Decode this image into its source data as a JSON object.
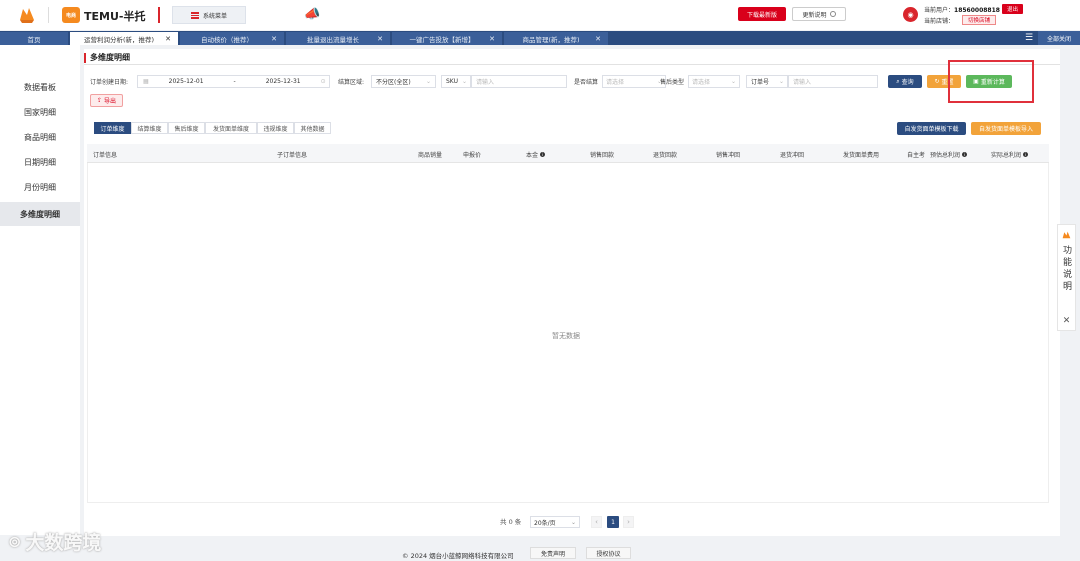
{
  "header": {
    "brand": "TEMU-半托",
    "logo2_text": "电商",
    "system_menu": "系统菜单",
    "download_btn": "下载最新版",
    "update_note_btn": "更新说明",
    "current_user_label": "当前用户：",
    "current_user": "18560008818",
    "logout": "退出",
    "current_shop_label": "当前店铺：",
    "switch_shop": "切换店铺"
  },
  "tabs": [
    {
      "label": "首页",
      "active": false,
      "closable": false
    },
    {
      "label": "运营利润分析(新，推荐)",
      "active": true,
      "closable": true
    },
    {
      "label": "自动核价（推荐）",
      "active": false,
      "closable": true
    },
    {
      "label": "批量退出流量增长",
      "active": false,
      "closable": true
    },
    {
      "label": "一键广告投放【新增】",
      "active": false,
      "closable": true
    },
    {
      "label": "商品管理(新，推荐)",
      "active": false,
      "closable": true
    }
  ],
  "close_all": "全部关闭",
  "sidebar": {
    "items": [
      {
        "label": "数据看板",
        "active": false
      },
      {
        "label": "国家明细",
        "active": false
      },
      {
        "label": "商品明细",
        "active": false
      },
      {
        "label": "日期明细",
        "active": false
      },
      {
        "label": "月份明细",
        "active": false
      },
      {
        "label": "多维度明细",
        "active": true
      }
    ]
  },
  "page_title": "多维度明细",
  "filters": {
    "order_date_label": "订单创建日期:",
    "start_date": "2025-12-01",
    "date_sep": "-",
    "end_date": "2025-12-31",
    "region_label": "结算区域:",
    "region_value": "不分区(全区)",
    "sku_select": "SKU",
    "sku_placeholder": "请输入",
    "settled_label": "是否结算",
    "settled_placeholder": "请选择",
    "aftersale_label": "售后类型",
    "aftersale_placeholder": "请选择",
    "order_no_select": "订单号",
    "order_no_placeholder": "请输入"
  },
  "buttons": {
    "query": "查询",
    "reset": "重置",
    "recalc": "重新计算",
    "export": "导出",
    "download_template": "自发货面单模板下载",
    "import_template": "自发货面单模板导入"
  },
  "dimension_tabs": [
    {
      "label": "订单维度",
      "active": true
    },
    {
      "label": "结算维度",
      "active": false
    },
    {
      "label": "售后维度",
      "active": false
    },
    {
      "label": "发货面单维度",
      "active": false
    },
    {
      "label": "违规维度",
      "active": false
    },
    {
      "label": "其他数据",
      "active": false
    }
  ],
  "table": {
    "columns": [
      {
        "label": "订单信息",
        "info": false
      },
      {
        "label": "子订单信息",
        "info": false
      },
      {
        "label": "商品销量",
        "info": false
      },
      {
        "label": "申报价",
        "info": false
      },
      {
        "label": "本金",
        "info": true
      },
      {
        "label": "销售回款",
        "info": false
      },
      {
        "label": "退货回款",
        "info": false
      },
      {
        "label": "销售冲回",
        "info": false
      },
      {
        "label": "退货冲回",
        "info": false
      },
      {
        "label": "发货面单费用",
        "info": false
      },
      {
        "label": "自主考",
        "info": false
      },
      {
        "label": "预估总利润",
        "info": true
      },
      {
        "label": "实际总利润",
        "info": true
      }
    ],
    "empty_text": "暂无数据"
  },
  "pagination": {
    "total": "共 0 条",
    "page_size": "20条/页",
    "current_page": "1"
  },
  "footer": {
    "copyright": "© 2024 烟台小蓝鲸网络科技有限公司",
    "disclaimer": "免责声明",
    "license": "授权协议"
  },
  "side_widget": {
    "label": "功能说明"
  },
  "watermark": "大数跨境",
  "colors": {
    "accent_red": "#d9001b",
    "nav_blue": "#2b4c80",
    "query_blue": "#2b4c80",
    "reset_orange": "#f2a33a",
    "recalc_green": "#5cb85c"
  }
}
